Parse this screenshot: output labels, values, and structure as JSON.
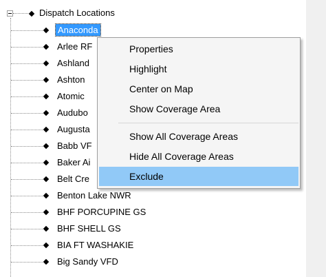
{
  "tree": {
    "root_label": "Dispatch Locations",
    "children": [
      "Anaconda",
      "Arlee RF",
      "Ashland",
      "Ashton",
      "Atomic",
      "Audubo",
      "Augusta",
      "Babb VF",
      "Baker Ai",
      "Belt Cre",
      "Benton Lake NWR",
      "BHF PORCUPINE GS",
      "BHF SHELL GS",
      "BIA FT WASHAKIE",
      "Big Sandy VFD"
    ],
    "selected_index": 0
  },
  "context_menu": {
    "items": [
      "Properties",
      "Highlight",
      "Center on Map",
      "Show Coverage Area",
      "Show All Coverage Areas",
      "Hide All Coverage Areas",
      "Exclude"
    ],
    "highlighted_item": "Exclude"
  },
  "colors": {
    "selection": "#3399ff",
    "menu_hover": "#91c9f7",
    "menu_background": "#f5f5f5"
  }
}
